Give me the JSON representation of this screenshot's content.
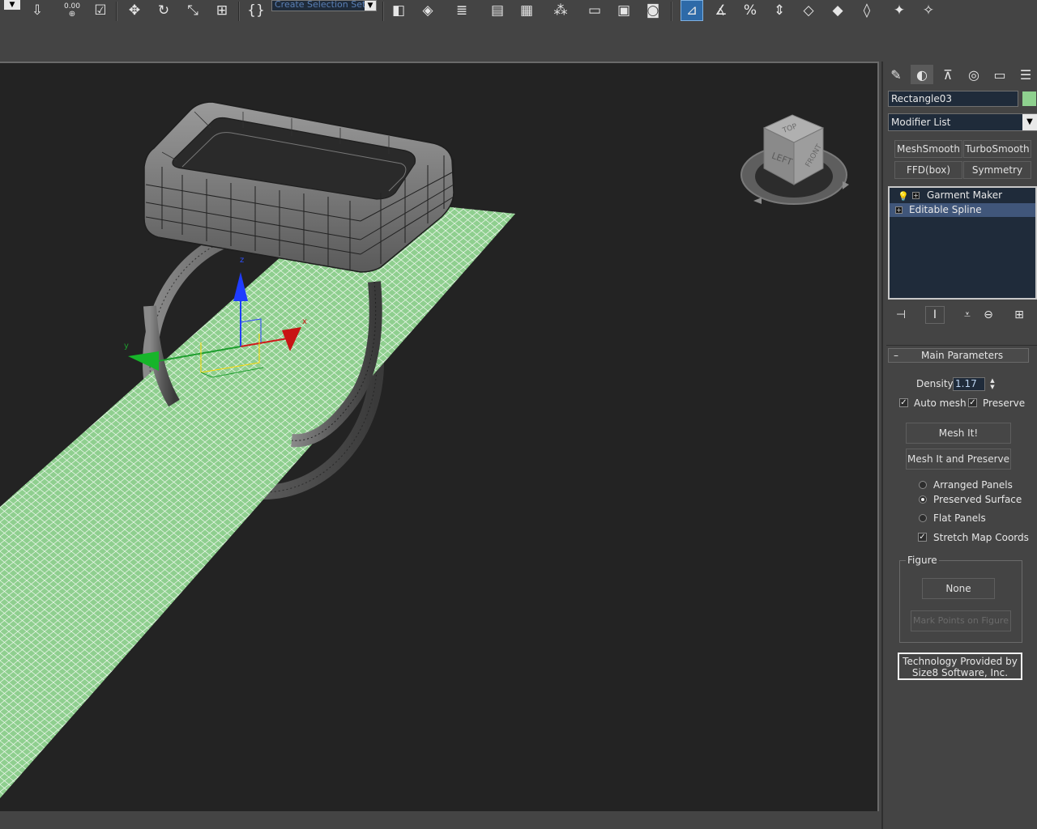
{
  "toolbar": {
    "selection_set_placeholder": "Create Selection Set",
    "spinner_readout": "0.00"
  },
  "viewport": {
    "viewcube": {
      "top_label": "TOP",
      "left_label": "LEFT",
      "front_label": "FRONT"
    },
    "gizmo": {
      "x_axis": "x",
      "y_axis": "y",
      "z_axis": "z"
    },
    "cloth_color": "#8fcf8f",
    "background_color": "#232323"
  },
  "command_panel": {
    "tabs": [
      "create-icon",
      "modify-icon",
      "hierarchy-icon",
      "motion-icon",
      "display-icon",
      "utilities-icon"
    ],
    "object_name": "Rectangle03",
    "object_color": "#8fd18f",
    "modifier_list": "Modifier List",
    "modifier_buttons": [
      "MeshSmooth",
      "TurboSmooth",
      "FFD(box)",
      "Symmetry"
    ],
    "stack": [
      "Garment Maker",
      "Editable Spline"
    ],
    "rollout_title": "Main Parameters",
    "density_label": "Density",
    "density_value": "1.17",
    "auto_mesh_label": "Auto mesh",
    "auto_mesh_checked": true,
    "preserve_label": "Preserve",
    "preserve_checked": true,
    "mesh_it_label": "Mesh It!",
    "mesh_it_preserve_label": "Mesh It and Preserve",
    "options": [
      "Arranged Panels",
      "Preserved Surface",
      "Flat Panels"
    ],
    "selected_option": "Preserved Surface",
    "stretch_map_label": "Stretch Map Coords",
    "stretch_map_checked": true,
    "figure_group_label": "Figure",
    "figure_button_label": "None",
    "mark_points_label": "Mark Points on Figure",
    "tech_line1": "Technology Provided by",
    "tech_line2": "Size8 Software, Inc."
  }
}
